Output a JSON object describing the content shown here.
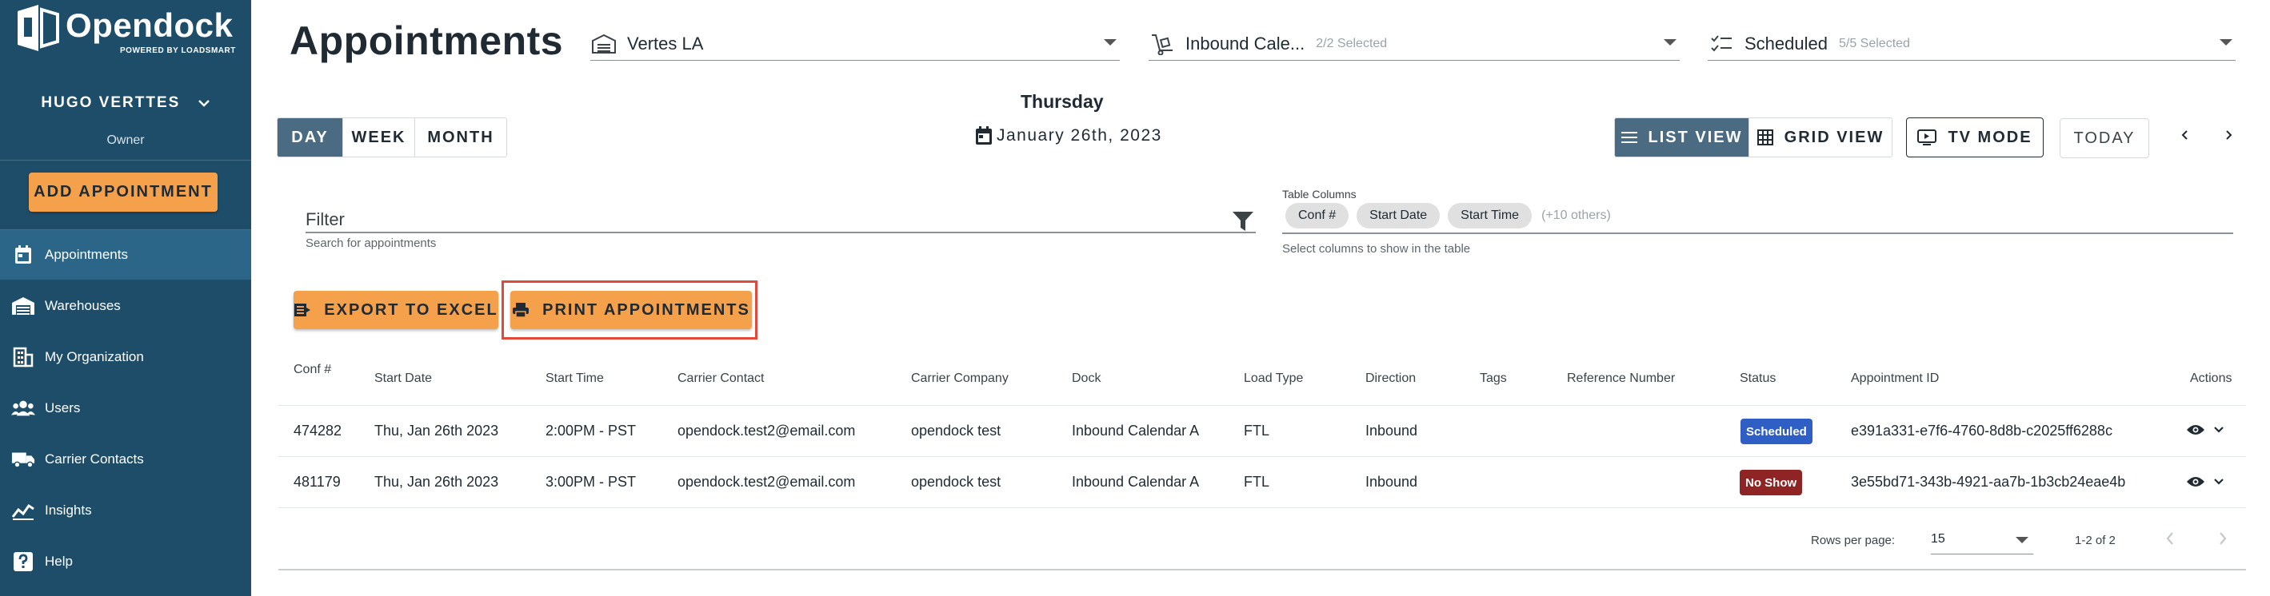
{
  "brand": {
    "name": "Opendock",
    "tagline": "POWERED BY LOADSMART"
  },
  "user": {
    "name": "HUGO VERTTES",
    "role": "Owner"
  },
  "sidebar": {
    "add_button": "ADD APPOINTMENT",
    "items": [
      {
        "label": "Appointments",
        "icon": "calendar-icon",
        "active": true
      },
      {
        "label": "Warehouses",
        "icon": "warehouse-icon",
        "active": false
      },
      {
        "label": "My Organization",
        "icon": "building-icon",
        "active": false
      },
      {
        "label": "Users",
        "icon": "users-icon",
        "active": false
      },
      {
        "label": "Carrier Contacts",
        "icon": "truck-icon",
        "active": false
      },
      {
        "label": "Insights",
        "icon": "chart-line-icon",
        "active": false
      },
      {
        "label": "Help",
        "icon": "help-icon",
        "active": false
      }
    ]
  },
  "header": {
    "title": "Appointments",
    "warehouse": {
      "value": "Vertes LA"
    },
    "calendar": {
      "value": "Inbound Cale...",
      "sub": "2/2 Selected"
    },
    "status": {
      "value": "Scheduled",
      "sub": "5/5 Selected"
    }
  },
  "view": {
    "ranges": [
      "DAY",
      "WEEK",
      "MONTH"
    ],
    "active_range": "DAY",
    "day_name": "Thursday",
    "date": "January 26th, 2023",
    "list_view": "LIST VIEW",
    "grid_view": "GRID VIEW",
    "tv_mode": "TV MODE",
    "today": "TODAY"
  },
  "filter": {
    "label": "Filter",
    "hint": "Search for appointments"
  },
  "columns_picker": {
    "label": "Table Columns",
    "chips": [
      "Conf #",
      "Start Date",
      "Start Time"
    ],
    "more": "(+10 others)",
    "hint": "Select columns to show in the table"
  },
  "actions": {
    "export": "EXPORT TO EXCEL",
    "print": "PRINT APPOINTMENTS"
  },
  "table": {
    "headers": [
      "Conf #",
      "Start Date",
      "Start Time",
      "Carrier Contact",
      "Carrier Company",
      "Dock",
      "Load Type",
      "Direction",
      "Tags",
      "Reference Number",
      "Status",
      "Appointment ID",
      "Actions"
    ],
    "rows": [
      {
        "conf": "474282",
        "start_date": "Thu, Jan 26th 2023",
        "start_time": "2:00PM - PST",
        "contact": "opendock.test2@email.com",
        "company": "opendock test",
        "dock": "Inbound Calendar A",
        "load_type": "FTL",
        "direction": "Inbound",
        "tags": "",
        "reference": "",
        "status": "Scheduled",
        "status_color": "#2f5fc4",
        "appointment_id": "e391a331-e7f6-4760-8d8b-c2025ff6288c"
      },
      {
        "conf": "481179",
        "start_date": "Thu, Jan 26th 2023",
        "start_time": "3:00PM - PST",
        "contact": "opendock.test2@email.com",
        "company": "opendock test",
        "dock": "Inbound Calendar A",
        "load_type": "FTL",
        "direction": "Inbound",
        "tags": "",
        "reference": "",
        "status": "No Show",
        "status_color": "#8e2424",
        "appointment_id": "3e55bd71-343b-4921-aa7b-1b3cb24eae4b"
      }
    ]
  },
  "pagination": {
    "rows_per_page_label": "Rows per page:",
    "rows_per_page": "15",
    "range": "1-2 of 2"
  },
  "colors": {
    "sidebar": "#1e4d69",
    "sidebar_active": "#2b6587",
    "accent": "#f5a04a",
    "highlight": "#e04a3a",
    "segment_active": "#4a6b82"
  }
}
